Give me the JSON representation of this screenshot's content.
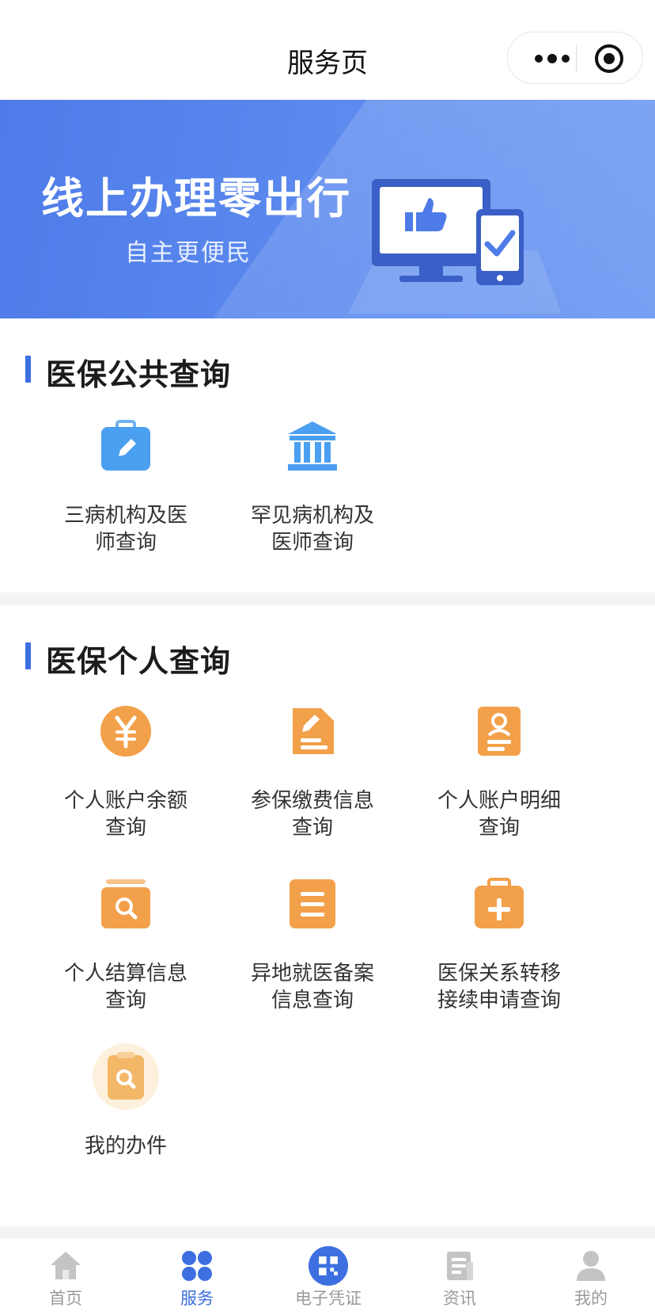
{
  "header": {
    "title": "服务页"
  },
  "banner": {
    "title": "线上办理零出行",
    "subtitle": "自主更便民"
  },
  "public_section": {
    "title": "医保公共查询",
    "items": [
      {
        "label": "三病机构及医\n师查询",
        "icon": "edit-briefcase-icon"
      },
      {
        "label": "罕见病机构及\n医师查询",
        "icon": "institution-building-icon"
      }
    ]
  },
  "personal_section": {
    "title": "医保个人查询",
    "items": [
      {
        "label": "个人账户余额\n查询",
        "icon": "yuan-coin-icon"
      },
      {
        "label": "参保缴费信息\n查询",
        "icon": "edit-document-icon"
      },
      {
        "label": "个人账户明细\n查询",
        "icon": "user-profile-card-icon"
      },
      {
        "label": "个人结算信息\n查询",
        "icon": "search-folder-icon"
      },
      {
        "label": "异地就医备案\n信息查询",
        "icon": "list-document-icon"
      },
      {
        "label": "医保关系转移\n接续申请查询",
        "icon": "medical-kit-icon"
      },
      {
        "label": "我的办件",
        "icon": "search-clipboard-icon"
      }
    ]
  },
  "tabbar": {
    "active": "服务",
    "tabs": [
      {
        "label": "首页",
        "icon": "home-icon"
      },
      {
        "label": "服务",
        "icon": "services-grid-icon"
      },
      {
        "label": "电子凭证",
        "icon": "qr-code-icon"
      },
      {
        "label": "资讯",
        "icon": "news-icon"
      },
      {
        "label": "我的",
        "icon": "user-icon"
      }
    ]
  },
  "colors": {
    "accent": "#3d6fe0",
    "orange": "#f3a04a",
    "banner": "#5a88ee"
  }
}
